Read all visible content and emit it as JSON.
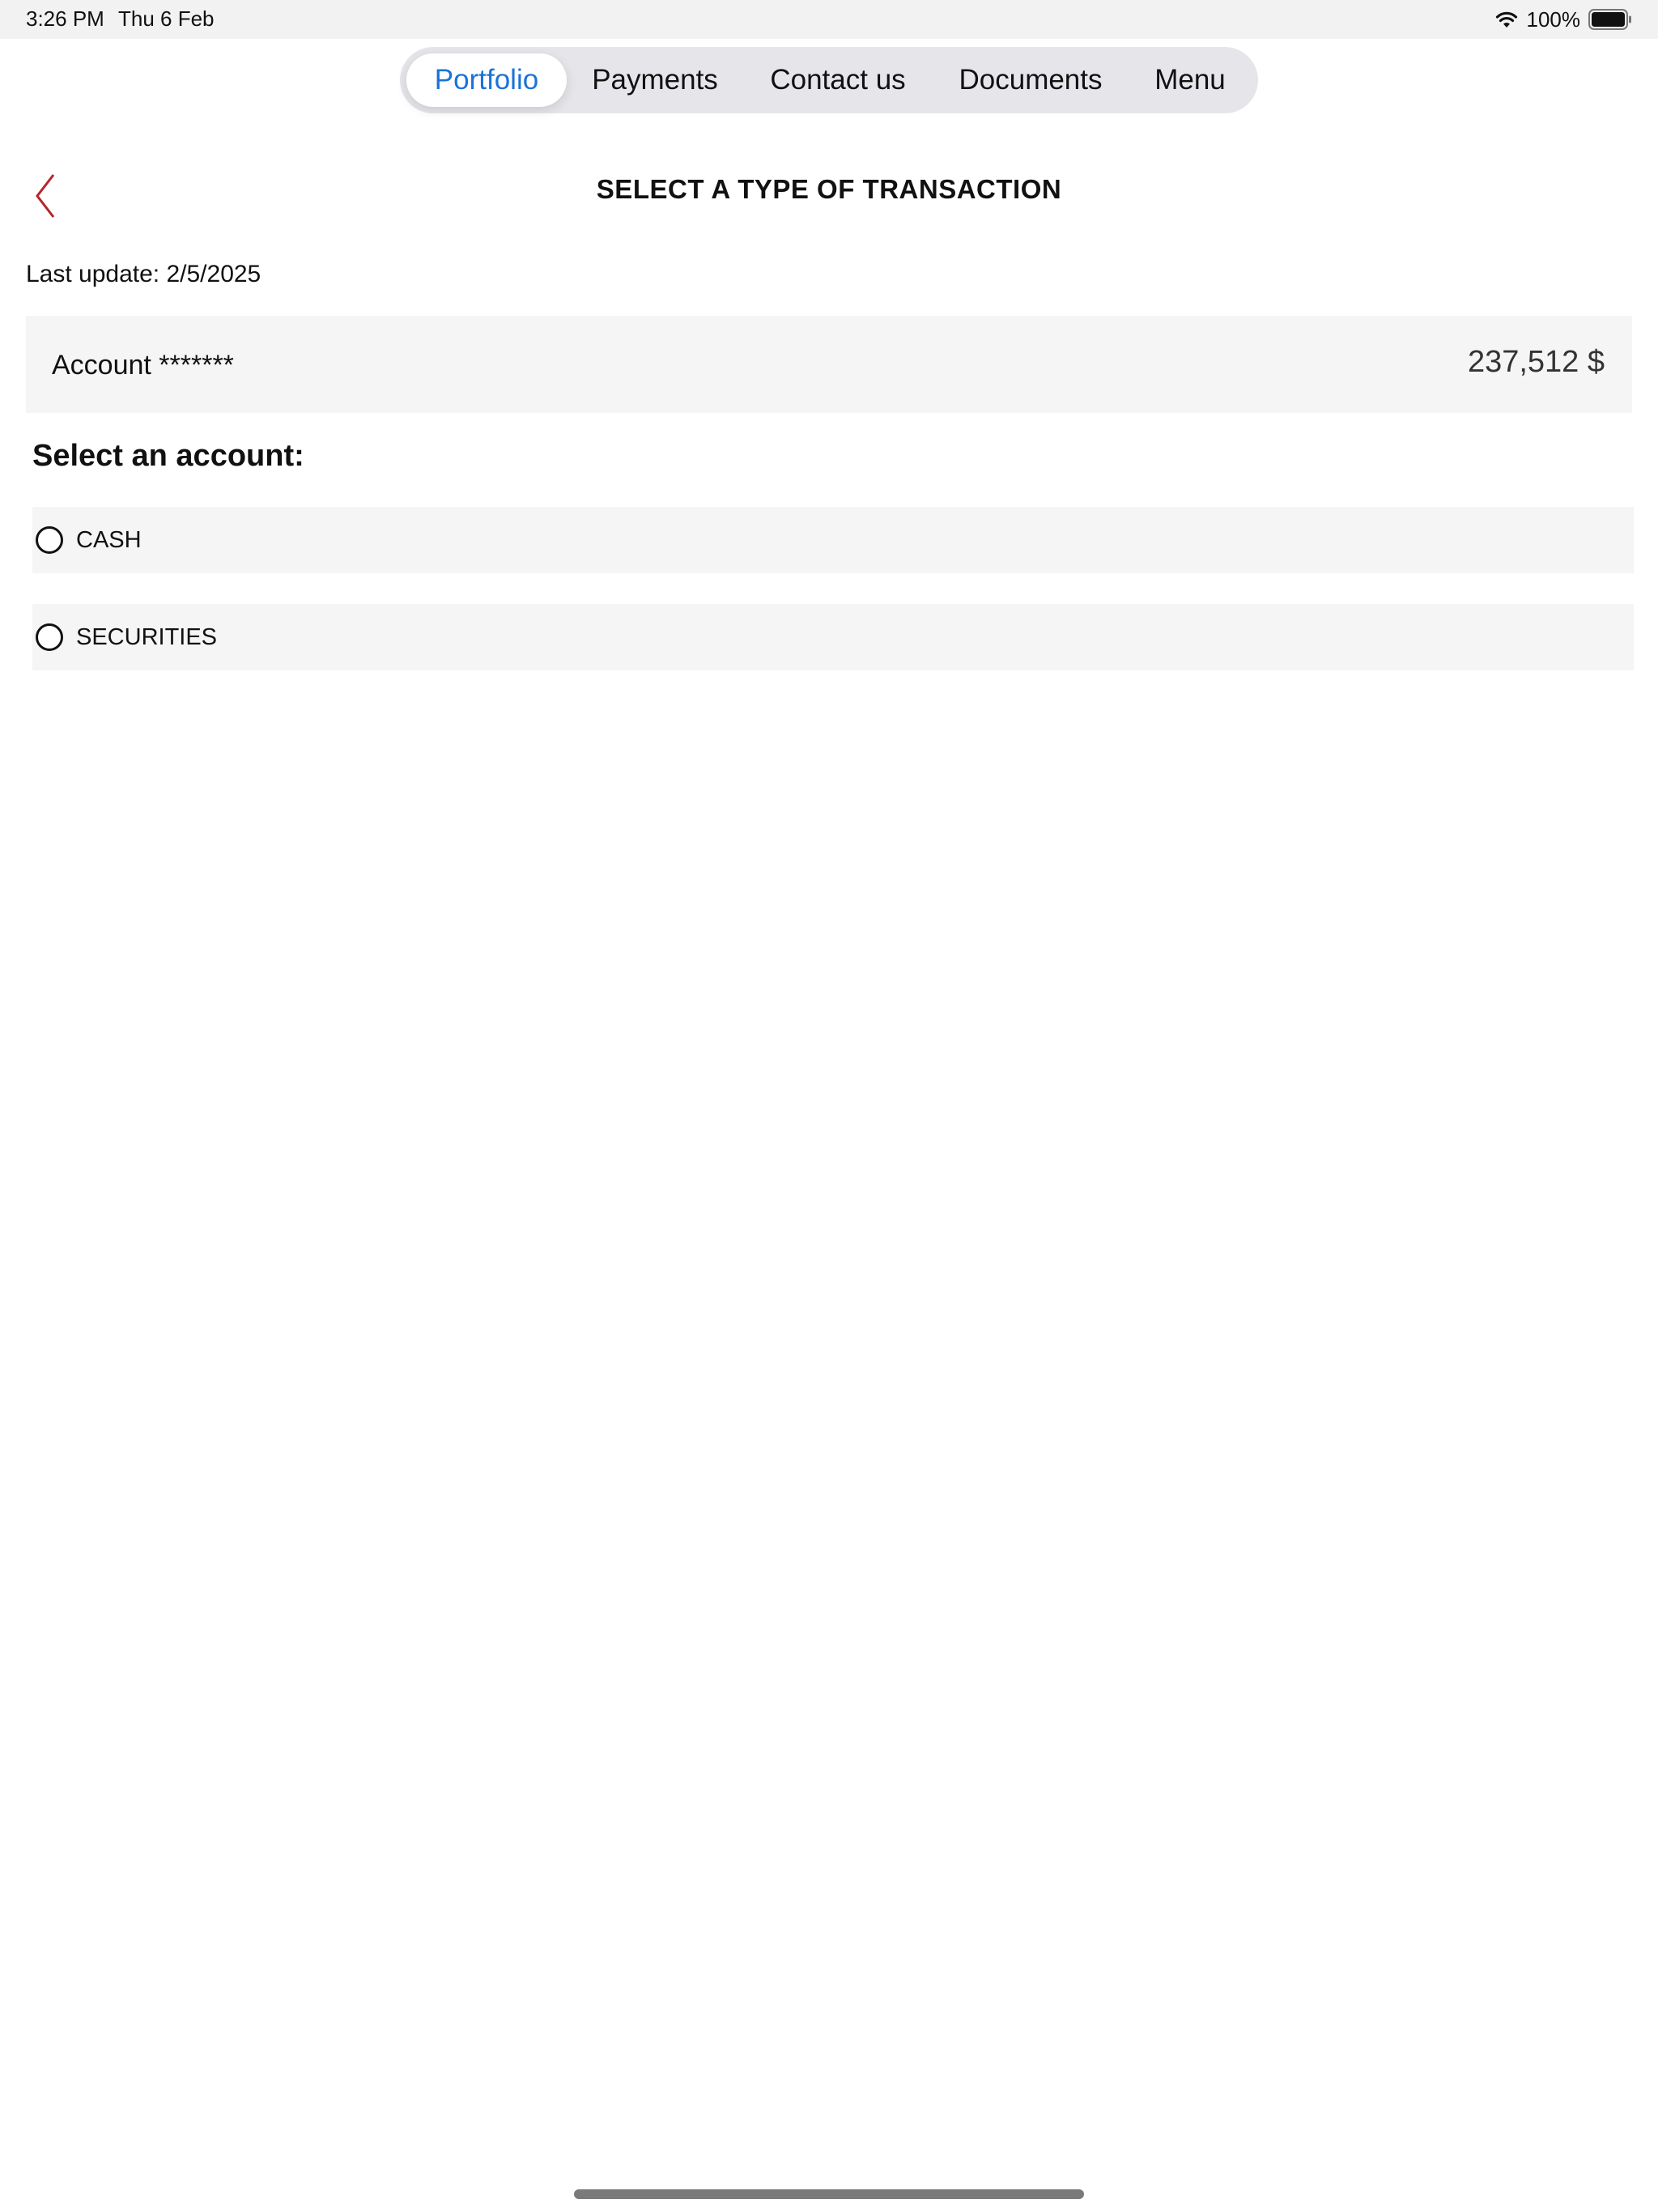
{
  "status_bar": {
    "time": "3:26 PM",
    "date": "Thu 6 Feb",
    "battery_percent": "100%",
    "wifi_icon": "wifi-icon",
    "battery_icon": "battery-icon"
  },
  "nav_tabs": [
    {
      "label": "Portfolio",
      "active": true
    },
    {
      "label": "Payments",
      "active": false
    },
    {
      "label": "Contact us",
      "active": false
    },
    {
      "label": "Documents",
      "active": false
    },
    {
      "label": "Menu",
      "active": false
    }
  ],
  "header": {
    "back_icon": "chevron-left-icon",
    "title": "SELECT A TYPE OF TRANSACTION"
  },
  "last_update": "Last update: 2/5/2025",
  "account": {
    "label": "Account *******",
    "balance": "237,512 $"
  },
  "select_heading": "Select an account:",
  "account_options": [
    {
      "label": "CASH",
      "selected": false
    },
    {
      "label": "SECURITIES",
      "selected": false
    }
  ],
  "colors": {
    "accent": "#1a73d9",
    "back_chevron": "#b3262a",
    "panel_bg": "#f5f5f5",
    "segment_bg": "#e6e6ea",
    "status_bar_bg": "#f2f2f2"
  }
}
